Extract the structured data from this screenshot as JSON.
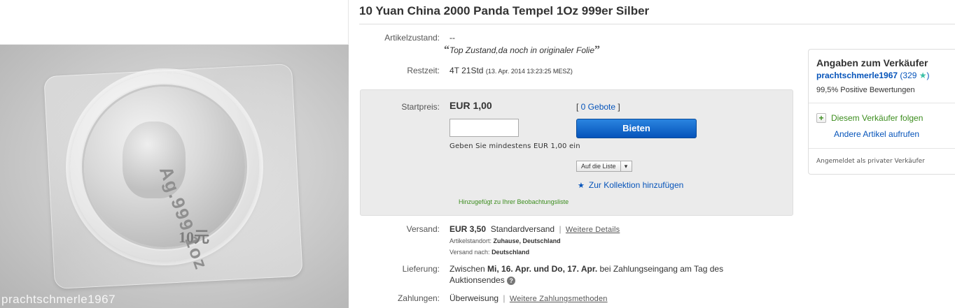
{
  "listing": {
    "title": "10 Yuan China 2000 Panda Tempel 1Oz 999er Silber"
  },
  "image": {
    "watermark": "prachtschmerle1967",
    "coin_text": "Ag.999 1oz",
    "coin_value": "10元"
  },
  "condition": {
    "label": "Artikelzustand:",
    "value": "--",
    "quote": "Top Zustand,da noch in originaler Folie"
  },
  "remaining": {
    "label": "Restzeit:",
    "value": "4T 21Std",
    "detail": "(13. Apr. 2014   13:23:25 MESZ)"
  },
  "bid": {
    "start_label": "Startpreis:",
    "price": "EUR 1,00",
    "bids_open": "[ ",
    "bids_link": "0 Gebote",
    "bids_close": " ]",
    "input_value": "",
    "button": "Bieten",
    "min_bid": "Geben Sie mindestens EUR 1,00 ein",
    "list_dropdown": "Auf die Liste",
    "collection": "Zur Kollektion hinzufügen",
    "watchlist_msg": "Hinzugefügt zu Ihrer Beobachtungsliste"
  },
  "shipping": {
    "label": "Versand:",
    "price": "EUR 3,50",
    "method": "Standardversand",
    "details_link": "Weitere Details",
    "location_label": "Artikelstandort:",
    "location": "Zuhause, Deutschland",
    "to_label": "Versand nach:",
    "to": "Deutschland"
  },
  "delivery": {
    "label": "Lieferung:",
    "prefix": "Zwischen ",
    "dates": "Mi, 16. Apr. und Do, 17. Apr.",
    "suffix": " bei Zahlungseingang am Tag des",
    "line2": "Auktionsendes",
    "help_icon": "?"
  },
  "payment": {
    "label": "Zahlungen:",
    "value": "Überweisung",
    "sep": "|",
    "link": "Weitere Zahlungsmethoden"
  },
  "seller": {
    "heading": "Angaben zum Verkäufer",
    "name": "prachtschmerle1967",
    "score_open": " (329 ",
    "score_close": ")",
    "positive": "99,5% Positive Bewertungen",
    "follow": "Diesem Verkäufer folgen",
    "other_items": "Andere Artikel aufrufen",
    "private": "Angemeldet als privater Verkäufer"
  },
  "colors": {
    "link_blue": "#0654ba",
    "green": "#3c8d1e",
    "bid_button": "#0654ba",
    "star_teal": "#3bbfa6"
  },
  "icons": {
    "quote": "quote-icon",
    "star": "star-icon",
    "help": "help-icon",
    "plus": "plus-icon",
    "dropdown": "chevron-down-icon"
  }
}
